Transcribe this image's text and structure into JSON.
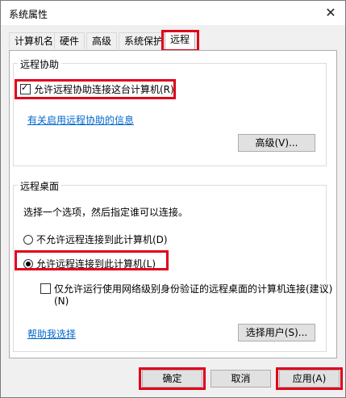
{
  "window": {
    "title": "系统属性"
  },
  "tabs": [
    "计算机名",
    "硬件",
    "高级",
    "系统保护",
    "远程"
  ],
  "remote_assistance": {
    "group_title": "远程协助",
    "allow_checkbox": "允许远程协助连接这台计算机(R)",
    "info_link": "有关启用远程协助的信息",
    "advanced_button": "高级(V)..."
  },
  "remote_desktop": {
    "group_title": "远程桌面",
    "instruction": "选择一个选项，然后指定谁可以连接。",
    "no_allow_radio": "不允许远程连接到此计算机(D)",
    "allow_radio": "允许远程连接到此计算机(L)",
    "nla_checkbox_line1": "仅允许运行使用网络级别身份验证的远程桌面的计算机连接(建议)",
    "nla_checkbox_line2": "(N)",
    "help_link": "帮助我选择",
    "select_users_button": "选择用户(S)..."
  },
  "footer": {
    "ok": "确定",
    "cancel": "取消",
    "apply": "应用(A)"
  }
}
